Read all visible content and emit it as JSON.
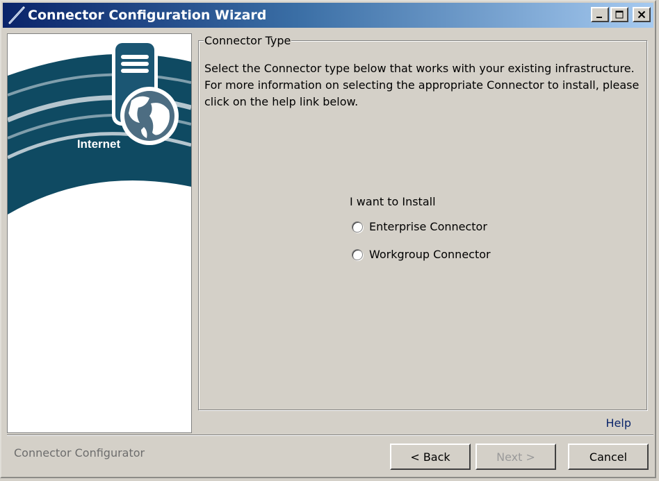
{
  "window": {
    "title": "Connector Configuration Wizard",
    "buttons": {
      "minimize": "minimize-icon",
      "maximize": "maximize-icon",
      "close": "close-icon"
    }
  },
  "sidebar": {
    "graphic_label": "Internet",
    "icons": [
      "server-icon",
      "globe-icon"
    ]
  },
  "connector_type": {
    "group_title": "Connector Type",
    "description": "Select the Connector type below that works with your existing infrastructure. For more information on selecting the appropriate Connector to install, please click on the help link below.",
    "install_label": "I want to Install",
    "options": [
      {
        "label": "Enterprise Connector",
        "selected": false
      },
      {
        "label": "Workgroup Connector",
        "selected": false
      }
    ],
    "help_link": "Help"
  },
  "footer": {
    "status": "Connector Configurator",
    "back_label": "< Back",
    "next_label": "Next >",
    "next_enabled": false,
    "cancel_label": "Cancel"
  },
  "colors": {
    "titlebar_start": "#0a246a",
    "titlebar_end": "#a6caf0",
    "dialog_bg": "#d4d0c8",
    "graphic_teal": "#0f4a62",
    "link": "#0a246a"
  }
}
